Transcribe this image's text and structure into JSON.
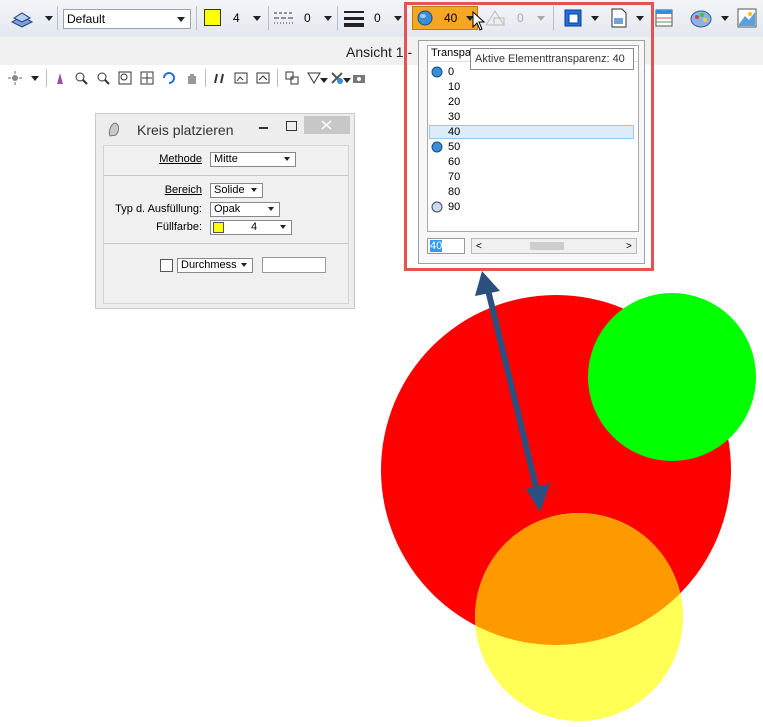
{
  "toolbar": {
    "level_value": "Default",
    "color_value": "4",
    "linestyle_value": "0",
    "lineweight_value": "0",
    "transparency_value": "40",
    "priority_value": "0",
    "colors": {
      "active_color": "#ffff00",
      "transparency_button_bg": "#f5a623"
    }
  },
  "view": {
    "title": "Ansicht 1 -"
  },
  "dialog": {
    "title": "Kreis platzieren",
    "methode_label": "Methode",
    "methode_value": "Mitte",
    "bereich_label": "Bereich",
    "bereich_value": "Solide",
    "ausfuellung_label": "Typ d. Ausfüllung:",
    "ausfuellung_value": "Opak",
    "fuellfarbe_label": "Füllfarbe:",
    "fuellfarbe_value": "4",
    "durchmesser_value": "Durchmess"
  },
  "popup": {
    "header": "Transpa",
    "tooltip": "Aktive Elementtransparenz: 40",
    "items": [
      "0",
      "10",
      "20",
      "30",
      "40",
      "50",
      "60",
      "70",
      "80",
      "90"
    ],
    "selected": "40",
    "input_value": "40"
  },
  "canvas": {
    "colors": {
      "red": "#ff0000",
      "green": "#00ff00",
      "orange": "#ff9900",
      "yellow": "#ffff55",
      "arrow": "#2b4f7e"
    }
  }
}
